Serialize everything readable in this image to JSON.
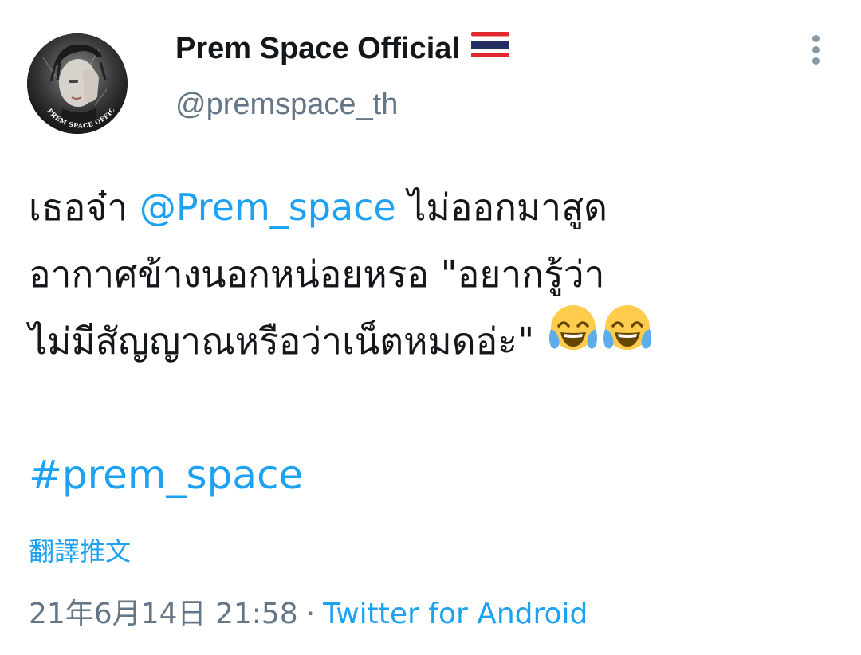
{
  "author": {
    "display_name": "Prem Space Official",
    "handle": "@premspace_th",
    "avatar_caption": "PREM SPACE OFFICIAL",
    "flag_icon": "thailand-flag-icon"
  },
  "tweet": {
    "line1_prefix": "เธอจ๋า ",
    "mention": "@Prem_space",
    "line1_suffix": " ไม่ออกมาสูด",
    "line2": "อากาศข้างนอกหน่อยหรอ \"อยากรู้ว่า",
    "line3": "ไม่มีสัญญาณหรือว่าเน็ตหมดอ่ะ\" ",
    "emoji": "face-with-tears-of-joy-icon",
    "hashtag": "#prem_space",
    "translate_label": "翻譯推文"
  },
  "meta": {
    "timestamp": "21年6月14日 21:58",
    "separator": "·",
    "source": "Twitter for Android"
  },
  "colors": {
    "link": "#1da1f2",
    "secondary_text": "#657786",
    "primary_text": "#14171a"
  }
}
